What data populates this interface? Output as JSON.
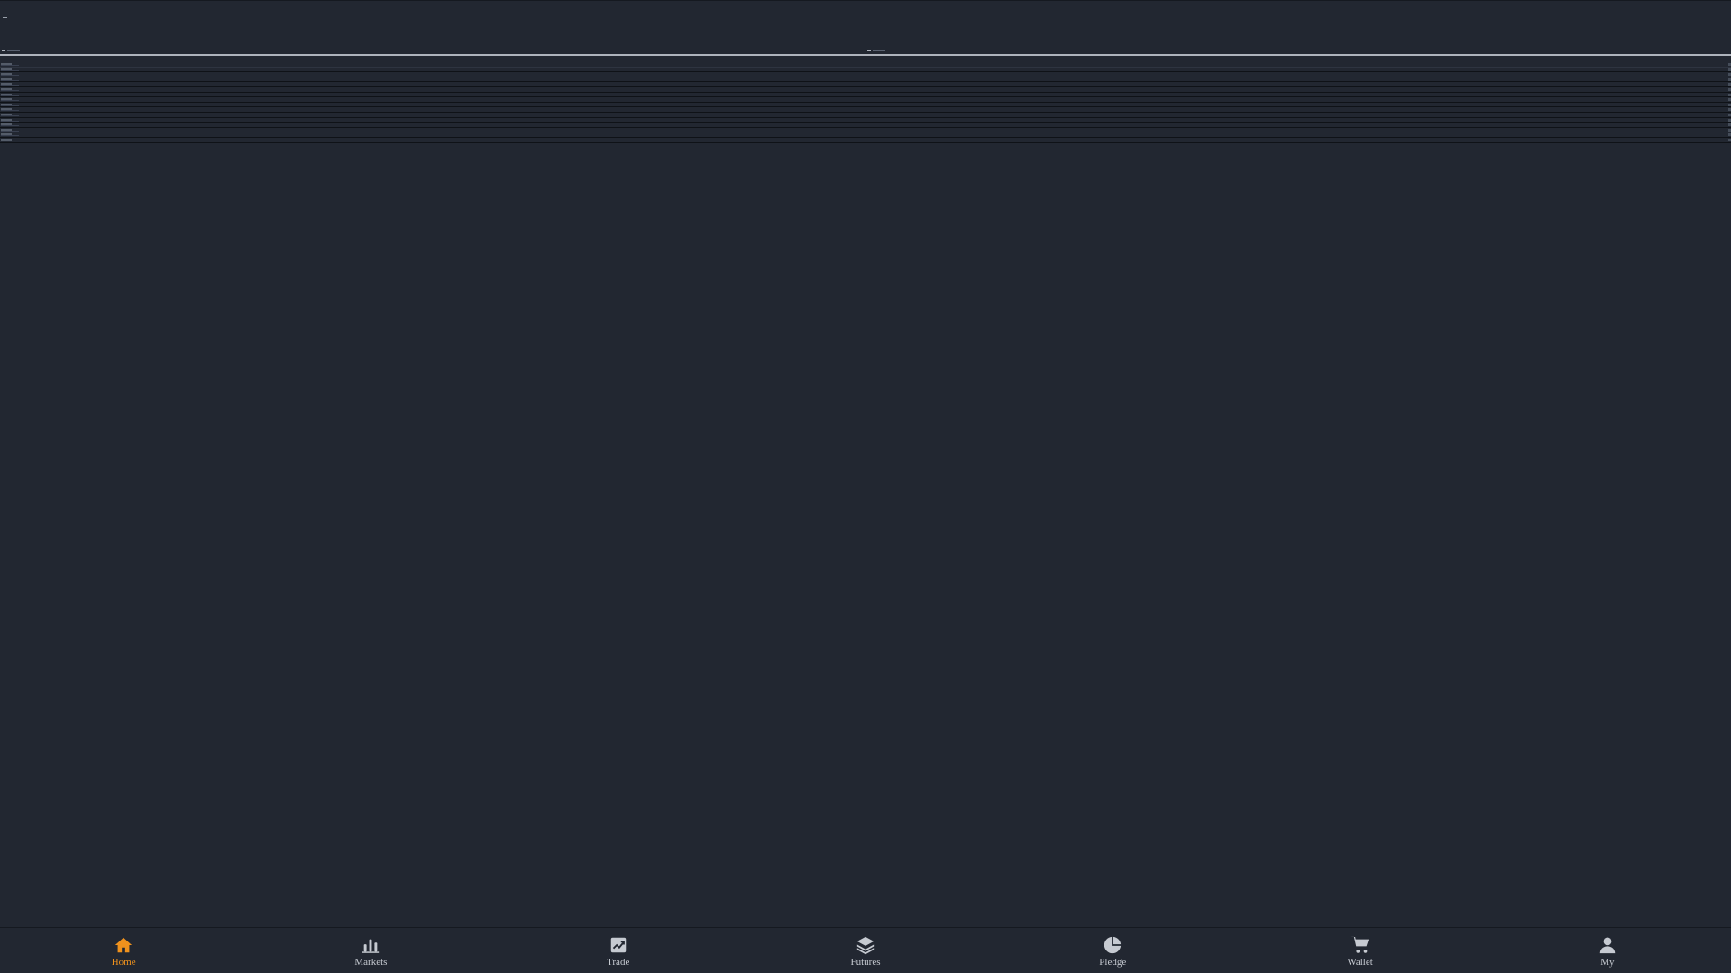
{
  "colors": {
    "background": "#222731",
    "nav_active": "#f0921d",
    "nav_inactive": "#c6cad1",
    "divider": "#aeb3bc"
  },
  "market_list": {
    "row_count": 16
  },
  "bottom_nav": {
    "items": [
      {
        "label": "Home",
        "icon": "home-icon",
        "active": true
      },
      {
        "label": "Markets",
        "icon": "bar-chart-icon",
        "active": false
      },
      {
        "label": "Trade",
        "icon": "trend-chart-icon",
        "active": false
      },
      {
        "label": "Futures",
        "icon": "layers-icon",
        "active": false
      },
      {
        "label": "Pledge",
        "icon": "pie-chart-icon",
        "active": false
      },
      {
        "label": "Wallet",
        "icon": "cart-icon",
        "active": false
      },
      {
        "label": "My",
        "icon": "user-icon",
        "active": false
      }
    ]
  }
}
